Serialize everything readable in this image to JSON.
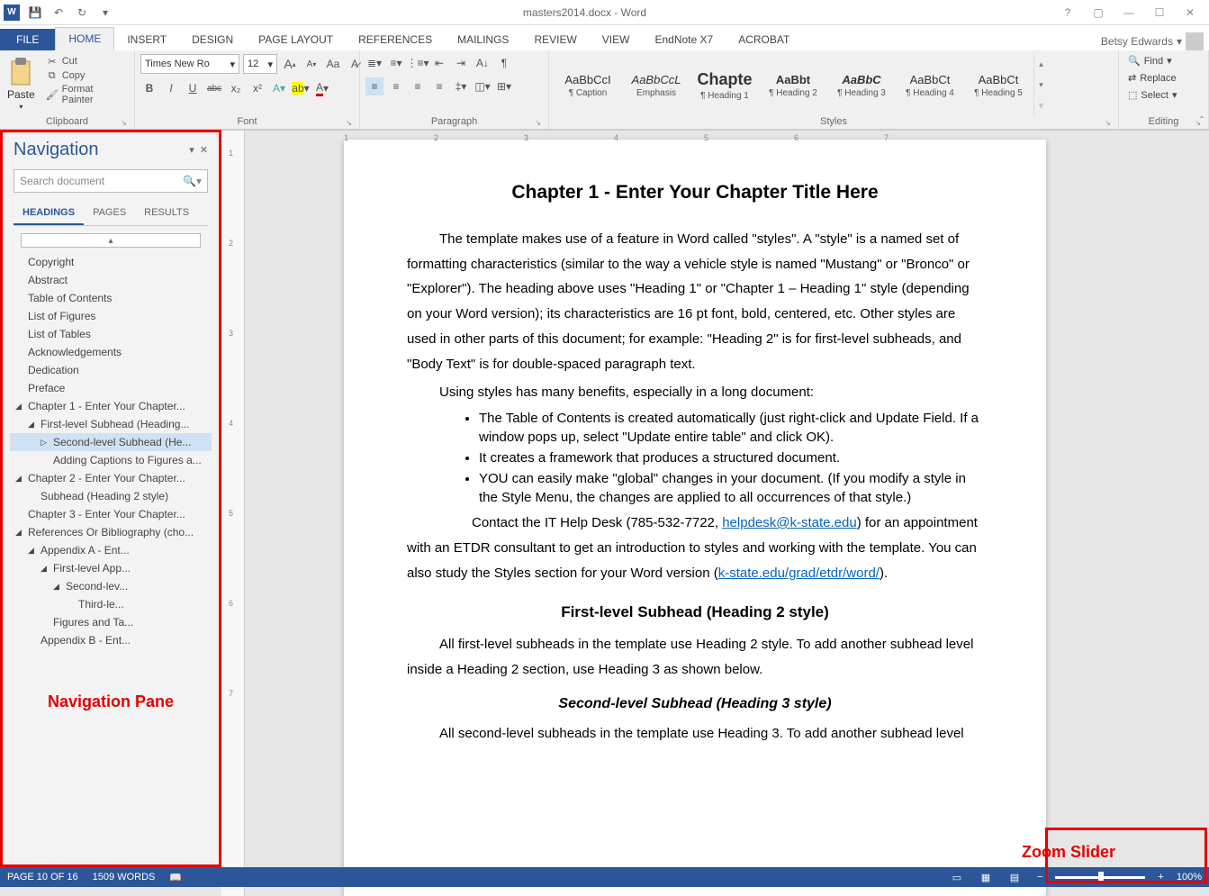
{
  "titlebar": {
    "title": "masters2014.docx - Word",
    "user": "Betsy Edwards"
  },
  "qat": {
    "save": "💾",
    "undo": "↶",
    "redo": "↻"
  },
  "menubar": {
    "file": "FILE",
    "tabs": [
      "HOME",
      "INSERT",
      "DESIGN",
      "PAGE LAYOUT",
      "REFERENCES",
      "MAILINGS",
      "REVIEW",
      "VIEW",
      "EndNote X7",
      "ACROBAT"
    ]
  },
  "ribbon": {
    "clipboard": {
      "paste": "Paste",
      "cut": "Cut",
      "copy": "Copy",
      "format_painter": "Format Painter",
      "label": "Clipboard"
    },
    "font": {
      "name": "Times New Ro",
      "size": "12",
      "grow": "A",
      "shrink": "A",
      "changecase": "Aa",
      "clear": "⌫",
      "bold": "B",
      "italic": "I",
      "underline": "U",
      "strike": "abc",
      "sub": "x₂",
      "sup": "x²",
      "texteffects": "A",
      "highlight": "ab",
      "fontcolor": "A",
      "label": "Font"
    },
    "paragraph": {
      "label": "Paragraph"
    },
    "styles": {
      "items": [
        {
          "sample": "AaBbCcI",
          "name": "¶ Caption"
        },
        {
          "sample": "AaBbCcL",
          "name": "Emphasis",
          "italic": true
        },
        {
          "sample": "Chapte",
          "name": "¶ Heading 1",
          "bold": true,
          "big": true
        },
        {
          "sample": "AaBbt",
          "name": "¶ Heading 2",
          "bold": true
        },
        {
          "sample": "AaBbC",
          "name": "¶ Heading 3",
          "italic": true,
          "bold": true
        },
        {
          "sample": "AaBbCt",
          "name": "¶ Heading 4"
        },
        {
          "sample": "AaBbCt",
          "name": "¶ Heading 5"
        }
      ],
      "label": "Styles"
    },
    "editing": {
      "find": "Find",
      "replace": "Replace",
      "select": "Select",
      "label": "Editing"
    }
  },
  "navpane": {
    "title": "Navigation",
    "search_placeholder": "Search document",
    "tabs": {
      "headings": "HEADINGS",
      "pages": "PAGES",
      "results": "RESULTS"
    },
    "tree": [
      {
        "level": 1,
        "label": "Copyright"
      },
      {
        "level": 1,
        "label": "Abstract"
      },
      {
        "level": 1,
        "label": "Table of Contents"
      },
      {
        "level": 1,
        "label": "List of Figures"
      },
      {
        "level": 1,
        "label": "List of Tables"
      },
      {
        "level": 1,
        "label": "Acknowledgements"
      },
      {
        "level": 1,
        "label": "Dedication"
      },
      {
        "level": 1,
        "label": "Preface"
      },
      {
        "level": 1,
        "label": "Chapter 1 -  Enter Your Chapter...",
        "caret": "◢"
      },
      {
        "level": 2,
        "label": "First-level Subhead (Heading...",
        "caret": "◢"
      },
      {
        "level": 3,
        "label": "Second-level Subhead (He...",
        "caret": "▷",
        "selected": true
      },
      {
        "level": 3,
        "label": "Adding Captions to Figures a..."
      },
      {
        "level": 1,
        "label": "Chapter 2 -  Enter Your Chapter...",
        "caret": "◢"
      },
      {
        "level": 2,
        "label": "Subhead (Heading 2 style)"
      },
      {
        "level": 1,
        "label": "Chapter 3 -  Enter Your Chapter..."
      },
      {
        "level": 1,
        "label": "References Or Bibliography (cho...",
        "caret": "◢"
      },
      {
        "level": 2,
        "label": "Appendix A -  Ent...",
        "caret": "◢"
      },
      {
        "level": 3,
        "label": "First-level App...",
        "caret": "◢"
      },
      {
        "level": 4,
        "label": "Second-lev...",
        "caret": "◢"
      },
      {
        "level": 5,
        "label": "Third-le..."
      },
      {
        "level": 3,
        "label": "Figures and Ta..."
      },
      {
        "level": 2,
        "label": "Appendix B -  Ent..."
      }
    ],
    "annotation": "Navigation Pane"
  },
  "ruler": {
    "h_ticks": [
      "1",
      "2",
      "3",
      "4",
      "5",
      "6",
      "7"
    ],
    "v_ticks": [
      "1",
      "2",
      "3",
      "4",
      "5",
      "6",
      "7"
    ]
  },
  "document": {
    "h1": "Chapter 1 - Enter Your Chapter Title Here",
    "p1": "The template makes use of a feature in Word called \"styles\".  A \"style\" is a named set of formatting characteristics (similar to the way a vehicle style is named \"Mustang\" or \"Bronco\" or \"Explorer\").  The heading above uses \"Heading 1\" or \"Chapter 1 – Heading 1\" style (depending on your Word version); its characteristics are 16 pt font, bold, centered, etc.   Other styles are used in other parts of this document; for example: \"Heading 2\" is for first-level subheads, and \"Body Text\" is for double-spaced paragraph text.",
    "p2": "Using styles has many benefits, especially in a long document:",
    "bullets": [
      "The Table of Contents is created automatically (just right-click and Update Field. If a window pops up, select \"Update entire table\" and click OK).",
      "It creates a framework that produces a structured document.",
      "YOU can easily make \"global\" changes in your document.  (If you modify a style in the Style Menu, the changes are applied to all occurrences of that style.)"
    ],
    "p3_a": "Contact the IT Help Desk (785-532-7722, ",
    "p3_link1": "helpdesk@k-state.edu",
    "p3_b": ") for an appointment with an ETDR consultant to get an introduction to styles and working with the template.  You can also study the Styles section for your Word version (",
    "p3_link2": "k-state.edu/grad/etdr/word/",
    "p3_c": ").",
    "h2": "First-level Subhead (Heading 2 style)",
    "p4": "All first-level subheads in the template use Heading 2 style.  To add another subhead level inside a Heading 2 section, use Heading 3 as shown below.",
    "h3": "Second-level Subhead (Heading 3 style)",
    "p5": "All second-level subheads in the template use Heading 3.  To add another subhead level"
  },
  "statusbar": {
    "page": "PAGE 10 OF 16",
    "words": "1509 WORDS",
    "zoom_pct": "100%"
  },
  "annotations": {
    "zoom": "Zoom Slider"
  }
}
